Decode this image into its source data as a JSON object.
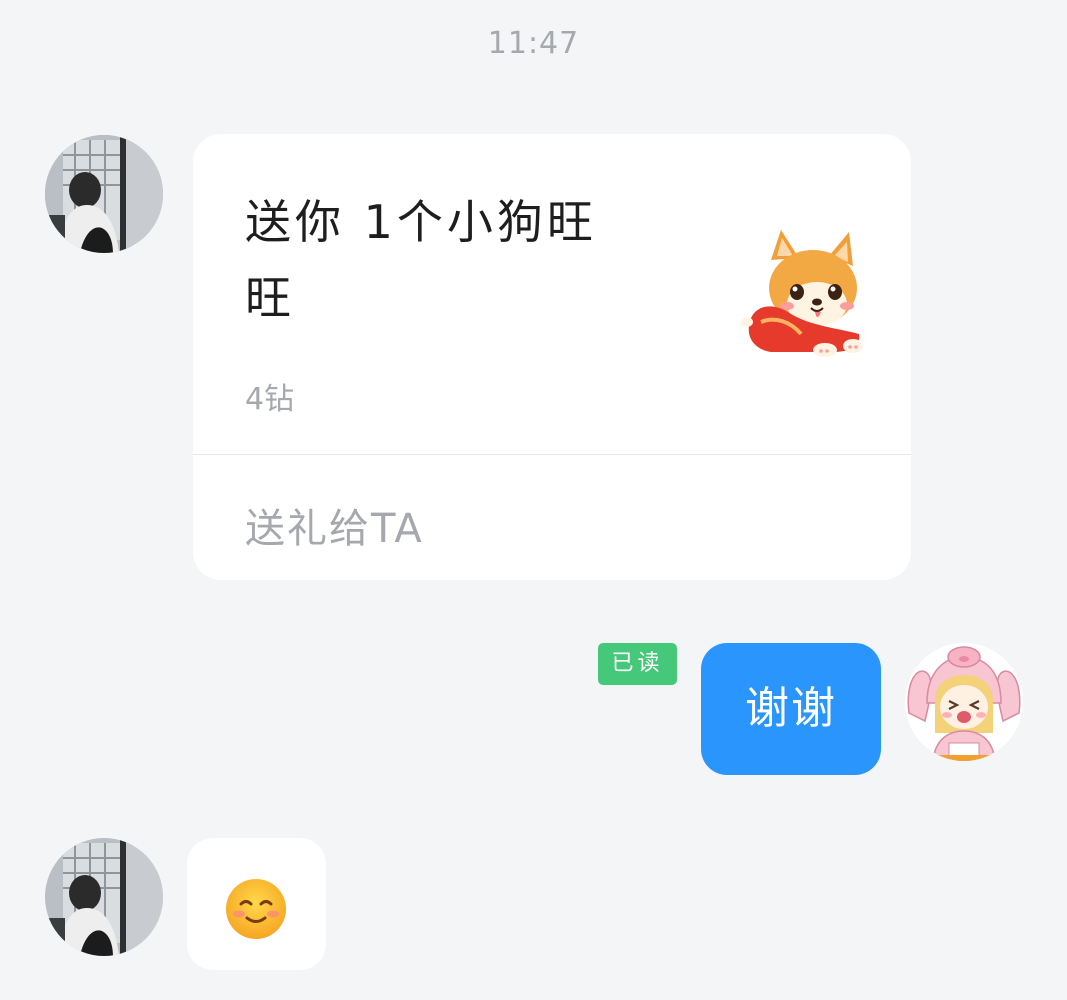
{
  "timestamp": "11:47",
  "messages": {
    "gift_card": {
      "title_line1": "送你 1个小狗旺",
      "title_line2": "旺",
      "price": "4钻",
      "action_label": "送礼给TA",
      "gift_icon": "corgi-puppy-icon"
    },
    "outgoing": {
      "read_status": "已读",
      "text": "谢谢"
    },
    "incoming_emoji": {
      "emoji": "smiling-face-icon"
    }
  },
  "colors": {
    "background": "#f4f5f7",
    "outgoing_bubble": "#2a95fc",
    "read_badge": "#46c87a",
    "muted_text": "#a5a8ad"
  }
}
